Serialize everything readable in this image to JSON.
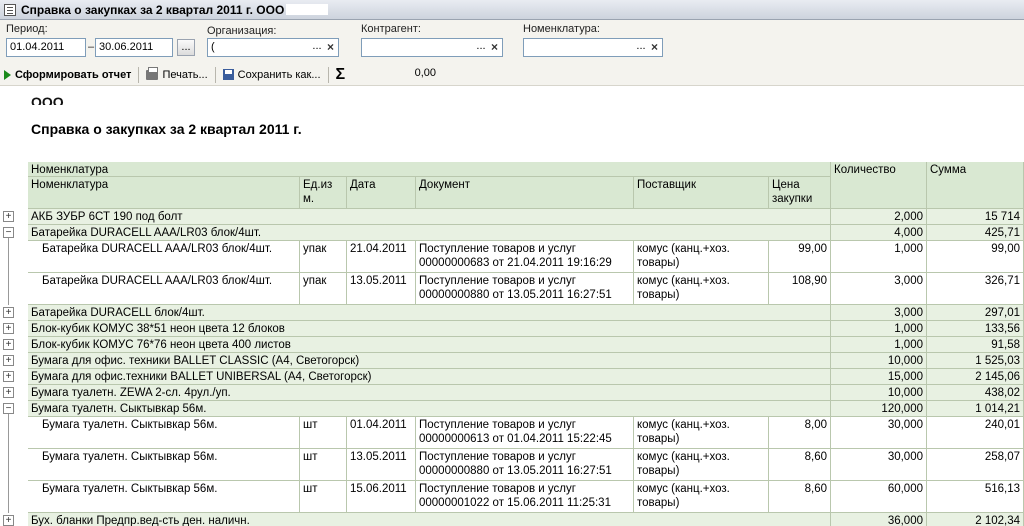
{
  "window": {
    "title": "Справка о закупках за 2 квартал 2011 г. ООО"
  },
  "filters": {
    "period_label": "Период:",
    "date_from": "01.04.2011",
    "dash": "–",
    "date_to": "30.06.2011",
    "period_btn": "...",
    "org_label": "Организация:",
    "org_value": "(",
    "contractor_label": "Контрагент:",
    "contractor_value": "",
    "nomenclature_label": "Номенклатура:",
    "nomenclature_value": "",
    "select_btn": "...",
    "clear_btn": "×"
  },
  "toolbar": {
    "generate": "Сформировать отчет",
    "print": "Печать...",
    "save": "Сохранить как...",
    "sigma": "Σ",
    "sum": "0,00"
  },
  "report": {
    "org_line": "ООО",
    "title": "Справка о закупках за 2 квартал 2011 г.",
    "header": {
      "group_nom": "Номенклатура",
      "nom": "Номенклатура",
      "unit": "Ед.из м.",
      "date": "Дата",
      "doc": "Документ",
      "supplier": "Поставщик",
      "price": "Цена закупки",
      "qty": "Количество",
      "sum": "Сумма"
    },
    "groups": [
      {
        "name": "АКБ ЗУБР 6СТ 190 под болт",
        "qty": "2,000",
        "sum": "15 714",
        "expanded": false,
        "rows": []
      },
      {
        "name": "Батарейка DURACELL AAA/LR03 блок/4шт.",
        "qty": "4,000",
        "sum": "425,71",
        "expanded": true,
        "rows": [
          {
            "nom": "Батарейка DURACELL AAA/LR03 блок/4шт.",
            "unit": "упак",
            "date": "21.04.2011",
            "doc1": "Поступление товаров и услуг",
            "doc2": "00000000683 от 21.04.2011 19:16:29",
            "sup1": "комус (канц.+хоз.",
            "sup2": "товары)",
            "price": "99,00",
            "qty": "1,000",
            "sum": "99,00"
          },
          {
            "nom": "Батарейка DURACELL AAA/LR03 блок/4шт.",
            "unit": "упак",
            "date": "13.05.2011",
            "doc1": "Поступление товаров и услуг",
            "doc2": "00000000880 от 13.05.2011 16:27:51",
            "sup1": "комус (канц.+хоз.",
            "sup2": "товары)",
            "price": "108,90",
            "qty": "3,000",
            "sum": "326,71"
          }
        ]
      },
      {
        "name": "Батарейка DURACELL блок/4шт.",
        "qty": "3,000",
        "sum": "297,01",
        "expanded": false,
        "rows": []
      },
      {
        "name": "Блок-кубик КОМУС  38*51 неон цвета 12 блоков",
        "qty": "1,000",
        "sum": "133,56",
        "expanded": false,
        "rows": []
      },
      {
        "name": "Блок-кубик КОМУС  76*76 неон цвета 400 листов",
        "qty": "1,000",
        "sum": "91,58",
        "expanded": false,
        "rows": []
      },
      {
        "name": "Бумага для офис. техники BALLET CLASSIC (А4, Светогорск)",
        "qty": "10,000",
        "sum": "1 525,03",
        "expanded": false,
        "rows": []
      },
      {
        "name": "Бумага для офис.техники BALLET UNIBERSAL (А4, Светогорск)",
        "qty": "15,000",
        "sum": "2 145,06",
        "expanded": false,
        "rows": []
      },
      {
        "name": "Бумага туалетн. ZEWA 2-сл. 4рул./уп.",
        "qty": "10,000",
        "sum": "438,02",
        "expanded": false,
        "rows": []
      },
      {
        "name": "Бумага туалетн. Сыктывкар 56м.",
        "qty": "120,000",
        "sum": "1 014,21",
        "expanded": true,
        "rows": [
          {
            "nom": "Бумага туалетн. Сыктывкар 56м.",
            "unit": "шт",
            "date": "01.04.2011",
            "doc1": "Поступление товаров и услуг",
            "doc2": "00000000613 от 01.04.2011 15:22:45",
            "sup1": "комус (канц.+хоз.",
            "sup2": "товары)",
            "price": "8,00",
            "qty": "30,000",
            "sum": "240,01"
          },
          {
            "nom": "Бумага туалетн. Сыктывкар 56м.",
            "unit": "шт",
            "date": "13.05.2011",
            "doc1": "Поступление товаров и услуг",
            "doc2": "00000000880 от 13.05.2011 16:27:51",
            "sup1": "комус (канц.+хоз.",
            "sup2": "товары)",
            "price": "8,60",
            "qty": "30,000",
            "sum": "258,07"
          },
          {
            "nom": "Бумага туалетн. Сыктывкар 56м.",
            "unit": "шт",
            "date": "15.06.2011",
            "doc1": "Поступление товаров и услуг",
            "doc2": "00000001022 от 15.06.2011 11:25:31",
            "sup1": "комус (канц.+хоз.",
            "sup2": "товары)",
            "price": "8,60",
            "qty": "60,000",
            "sum": "516,13"
          }
        ]
      },
      {
        "name": "Бух. бланки Предпр.вед-сть ден. наличн.",
        "qty": "36,000",
        "sum": "2 102,34",
        "expanded": false,
        "rows": []
      }
    ]
  }
}
